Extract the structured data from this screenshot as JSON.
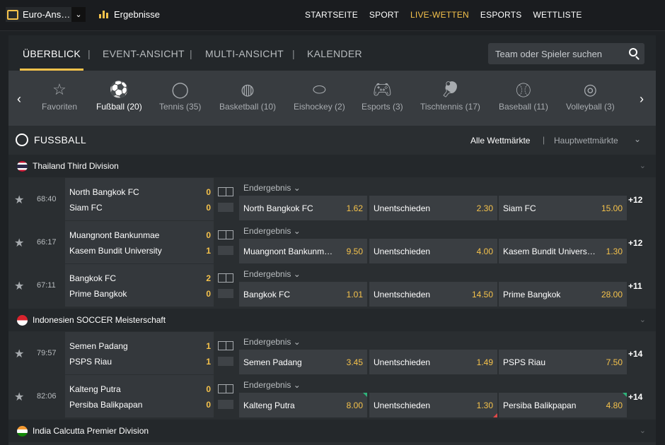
{
  "topbar": {
    "odds_format": "Euro-Ans…",
    "results_label": "Ergebnisse",
    "nav": [
      "STARTSEITE",
      "SPORT",
      "LIVE-WETTEN",
      "ESPORTS",
      "WETTLISTE"
    ]
  },
  "tabs": {
    "items": [
      "ÜBERBLICK",
      "EVENT-ANSICHT",
      "MULTI-ANSICHT",
      "KALENDER"
    ],
    "search_placeholder": "Team oder Spieler suchen"
  },
  "sports": [
    {
      "label": "Favoriten",
      "icon": "star-icon"
    },
    {
      "label": "Fußball (20)",
      "icon": "soccer-ball-icon"
    },
    {
      "label": "Tennis (35)",
      "icon": "tennis-ball-icon"
    },
    {
      "label": "Basketball (10)",
      "icon": "basketball-icon"
    },
    {
      "label": "Eishockey (2)",
      "icon": "hockey-puck-icon"
    },
    {
      "label": "Esports (3)",
      "icon": "gamepad-icon"
    },
    {
      "label": "Tischtennis (17)",
      "icon": "paddle-icon"
    },
    {
      "label": "Baseball (11)",
      "icon": "baseball-icon"
    },
    {
      "label": "Volleyball (3)",
      "icon": "volleyball-icon"
    }
  ],
  "section": {
    "title": "FUSSBALL",
    "all_markets": "Alle Wettmärkte",
    "main_markets": "Hauptwettmärkte"
  },
  "leagues": [
    {
      "name": "Thailand Third Division"
    },
    {
      "name": "Indonesien SOCCER Meisterschaft"
    },
    {
      "name": "India Calcutta Premier Division"
    }
  ],
  "market_label": "Endergebnis",
  "matches": [
    {
      "time": "68:40",
      "home": "North Bangkok FC",
      "away": "Siam FC",
      "home_score": "0",
      "away_score": "0",
      "o1_label": "North Bangkok FC",
      "o1": "1.62",
      "ox_label": "Unentschieden",
      "ox": "2.30",
      "o2_label": "Siam FC",
      "o2": "15.00",
      "more": "+12"
    },
    {
      "time": "66:17",
      "home": "Muangnont Bankunmae",
      "away": "Kasem Bundit University",
      "home_score": "0",
      "away_score": "1",
      "o1_label": "Muangnont Bankunm…",
      "o1": "9.50",
      "ox_label": "Unentschieden",
      "ox": "4.00",
      "o2_label": "Kasem Bundit Univers…",
      "o2": "1.30",
      "more": "+12"
    },
    {
      "time": "67:11",
      "home": "Bangkok FC",
      "away": "Prime Bangkok",
      "home_score": "2",
      "away_score": "0",
      "o1_label": "Bangkok FC",
      "o1": "1.01",
      "ox_label": "Unentschieden",
      "ox": "14.50",
      "o2_label": "Prime Bangkok",
      "o2": "28.00",
      "more": "+11"
    },
    {
      "time": "79:57",
      "home": "Semen Padang",
      "away": "PSPS Riau",
      "home_score": "1",
      "away_score": "1",
      "o1_label": "Semen Padang",
      "o1": "3.45",
      "ox_label": "Unentschieden",
      "ox": "1.49",
      "o2_label": "PSPS Riau",
      "o2": "7.50",
      "more": "+14"
    },
    {
      "time": "82:06",
      "home": "Kalteng Putra",
      "away": "Persiba Balikpapan",
      "home_score": "0",
      "away_score": "0",
      "o1_label": "Kalteng Putra",
      "o1": "8.00",
      "ox_label": "Unentschieden",
      "ox": "1.30",
      "o2_label": "Persiba Balikpapan",
      "o2": "4.80",
      "more": "+14"
    }
  ],
  "colors": {
    "accent": "#f5c24b",
    "up": "#2fb27a",
    "down": "#e04848"
  }
}
